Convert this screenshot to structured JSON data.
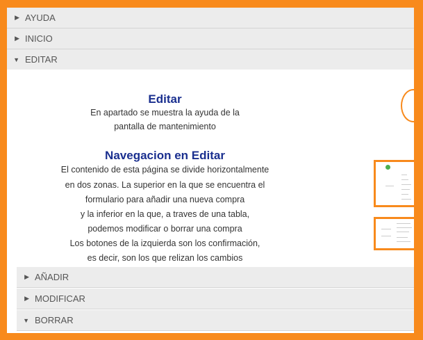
{
  "accordion": {
    "ayuda": "AYUDA",
    "inicio": "INICIO",
    "editar": "EDITAR",
    "anadir": "AÑADIR",
    "modificar": "MODIFICAR",
    "borrar": "BORRAR"
  },
  "editar": {
    "title": "Editar",
    "subtitle_lines": [
      "En apartado se muestra la ayuda de la",
      "pantalla de mantenimiento"
    ],
    "nav_title": "Navegacion en Editar",
    "nav_lines": [
      "El contenido de esta página se divide horizontalmente",
      "en dos zonas. La superior en la que se encuentra el",
      "formulario para añadir una nueva compra",
      "y la inferior en la que, a traves de una tabla,",
      "podemos modificar o borrar una compra",
      "Los botones de la izquierda son los confirmación,",
      "es decir, son los que relizan los cambios"
    ]
  },
  "colors": {
    "accent": "#f88a1c",
    "heading": "#1a2f8f",
    "header_bg": "#ececec"
  },
  "icons": {
    "collapsed": "triangle-right-icon",
    "expanded": "triangle-down-icon"
  }
}
